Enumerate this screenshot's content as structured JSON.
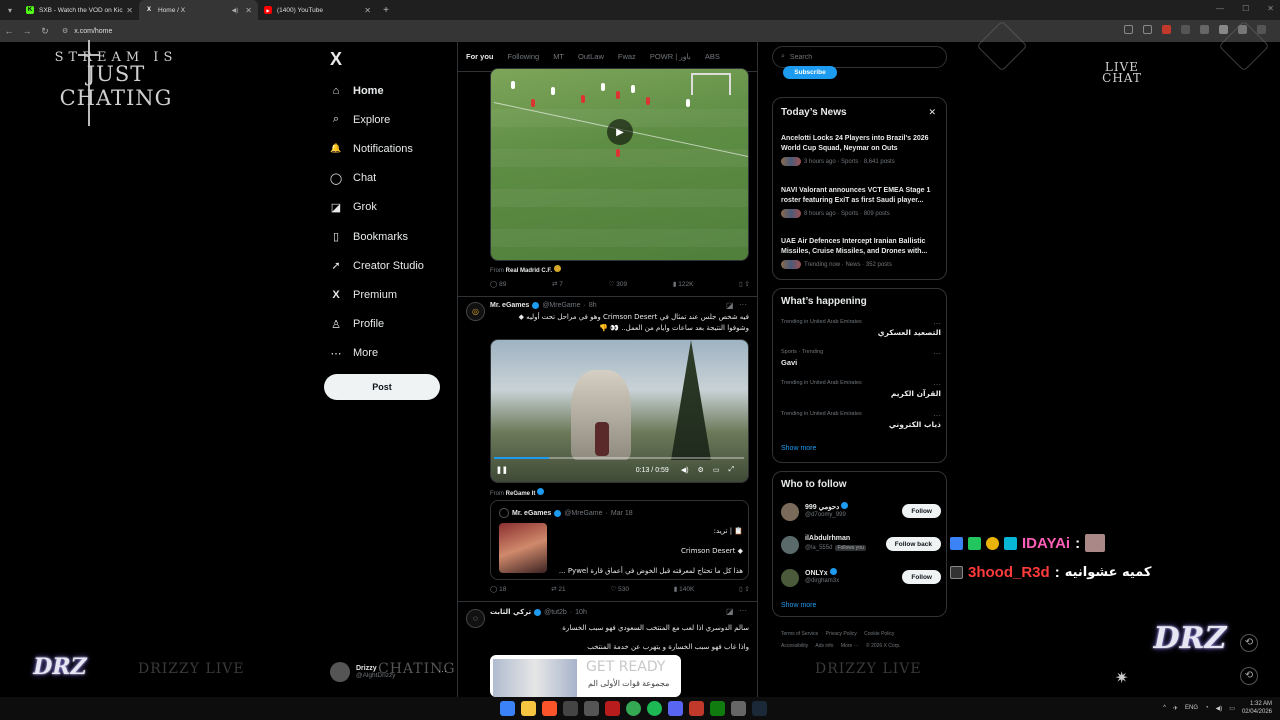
{
  "browser": {
    "tabs": [
      {
        "title": "SXB - Watch the VOD on Kick",
        "favicon_color": "#53fc18",
        "favicon_glyph": "K"
      },
      {
        "title": "Home / X",
        "favicon_color": "#ffffff",
        "favicon_glyph": "X"
      },
      {
        "title": "(1400) YouTube",
        "favicon_color": "#ff0000",
        "favicon_glyph": "▶"
      }
    ],
    "url": "x.com/home"
  },
  "overlay": {
    "logo_line1": "STREAM IS",
    "logo_line2": "JUST CHATING",
    "live_chat_line1": "LIVE",
    "live_chat_line2": "CHAT",
    "brand": "DRZ",
    "watermark_left": "DRIZZY LIVE",
    "watermark_mid": "CHATING",
    "watermark_right": "DRIZZY LIVE",
    "chat": [
      {
        "user": "IDAYAi",
        "sep": ":",
        "message": "",
        "user_color": "#ff5eb8"
      },
      {
        "user": "3hood_R3d",
        "sep": ":",
        "message": "كميه عشوانيه",
        "user_color": "#ff3b3b"
      }
    ]
  },
  "x_nav": {
    "logo": "X",
    "items": [
      {
        "label": "Home",
        "icon": "home-icon",
        "glyph": "⌂"
      },
      {
        "label": "Explore",
        "icon": "search-icon",
        "glyph": "⌕"
      },
      {
        "label": "Notifications",
        "icon": "bell-icon",
        "glyph": "🔔"
      },
      {
        "label": "Chat",
        "icon": "chat-icon",
        "glyph": "◯"
      },
      {
        "label": "Grok",
        "icon": "grok-icon",
        "glyph": "◪"
      },
      {
        "label": "Bookmarks",
        "icon": "bookmark-icon",
        "glyph": "▯"
      },
      {
        "label": "Creator Studio",
        "icon": "rocket-icon",
        "glyph": "➚"
      },
      {
        "label": "Premium",
        "icon": "x-premium-icon",
        "glyph": "X"
      },
      {
        "label": "Profile",
        "icon": "person-icon",
        "glyph": "♙"
      },
      {
        "label": "More",
        "icon": "more-circle-icon",
        "glyph": "⋯"
      }
    ],
    "post_label": "Post",
    "account": {
      "name": "Drizzy",
      "handle": "@AlghtDrizzy"
    }
  },
  "timeline": {
    "tabs": [
      "For you",
      "Following",
      "MT",
      "OutLaw",
      "Fwaz",
      "POWR | باور",
      "ABS"
    ],
    "post1": {
      "from_prefix": "From",
      "from_name": "Real Madrid C.F.",
      "stats": {
        "replies": "89",
        "reposts": "7",
        "likes": "309",
        "views": "122K"
      }
    },
    "post2": {
      "name": "Mr. eGames",
      "handle": "@MreGame",
      "time": "8h",
      "text_line1": "فيه شخص جلس عند تمثال في Crimson Desert وهو في مراحل تحت أوليه ◆",
      "text_line2": "وشوفوا النتيجة بعد ساعات وايام من العمل.. 👀 👎",
      "video_time": "0:13 / 0:59",
      "video_progress": 0.22,
      "from_prefix": "From",
      "from_name": "ReGame It",
      "quote": {
        "name": "Mr. eGames",
        "handle": "@MreGame",
        "date": "Mar 18",
        "line1": "📋 | تريد:",
        "line2": "◆ Crimson Desert",
        "line3": "هذا كل ما تحتاج لمعرفته قبل الخوض في أعماق قارة Pywel ..."
      },
      "stats": {
        "replies": "18",
        "reposts": "21",
        "likes": "530",
        "views": "140K"
      }
    },
    "post3": {
      "name": "تركي الثابت",
      "handle": "@tut2b",
      "time": "10h",
      "line1": "سالم الدوسري اذا لعب مع المنتخب السعودي فهو سبب الخسارة",
      "line2": "واذا غاب فهو سبب الخسارة و يتهرب عن خدمة المنتخب",
      "poster_title": "GET READY",
      "poster_sub": "مجموعة قوات الأولى الم"
    }
  },
  "sidebar": {
    "search_placeholder": "Search",
    "subscribe_label": "Subscribe",
    "news_title": "Today’s News",
    "news": [
      {
        "headline": "Ancelotti Locks 24 Players into Brazil's 2026 World Cup Squad, Neymar on Outs",
        "meta": "3 hours ago · Sports · 8,641 posts"
      },
      {
        "headline": "NAVI Valorant announces VCT EMEA Stage 1 roster featuring ExiT as first Saudi player...",
        "meta": "8 hours ago · Sports · 809 posts"
      },
      {
        "headline": "UAE Air Defences Intercept Iranian Ballistic Missiles, Cruise Missiles, and Drones with...",
        "meta": "Trending now · News · 352 posts"
      }
    ],
    "happening_title": "What’s happening",
    "trends": [
      {
        "context": "Trending in United Arab Emirates",
        "name": "التصعيد العسكري",
        "rtl": true
      },
      {
        "context": "Sports · Trending",
        "name": "Gavi",
        "rtl": false
      },
      {
        "context": "Trending in United Arab Emirates",
        "name": "القرآن الكريم",
        "rtl": true
      },
      {
        "context": "Trending in United Arab Emirates",
        "name": "ذباب الكتروني",
        "rtl": true
      }
    ],
    "show_more": "Show more",
    "wtf_title": "Who to follow",
    "follows": [
      {
        "name": "999 دحومي",
        "handle": "@d7oomy_999",
        "button": "Follow",
        "follows_you": ""
      },
      {
        "name": "ilAbdulrhman",
        "handle": "@la_555d",
        "button": "Follow back",
        "follows_you": "Follows you"
      },
      {
        "name": "ONLYx",
        "handle": "@dirgham3x",
        "button": "Follow",
        "follows_you": ""
      }
    ],
    "footer": [
      "Terms of Service",
      "Privacy Policy",
      "Cookie Policy",
      "Accessibility",
      "Ads info",
      "More ···",
      "© 2026 X Corp."
    ]
  },
  "taskbar": {
    "lang": "ENG",
    "time": "1:32 AM",
    "date": "02/04/2026"
  }
}
